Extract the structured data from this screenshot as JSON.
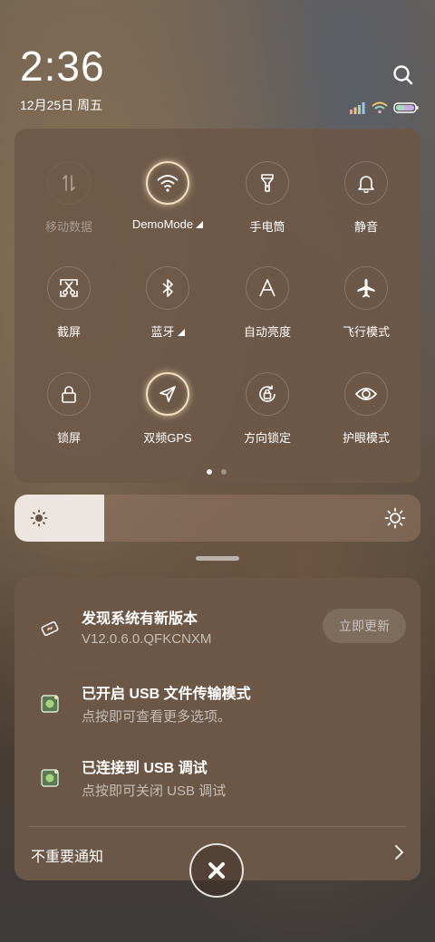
{
  "header": {
    "time": "2:36",
    "date": "12月25日 周五"
  },
  "quick_settings": {
    "tiles": [
      {
        "label": "移动数据",
        "icon": "mobile-data-icon",
        "state": "disabled"
      },
      {
        "label": "DemoMode",
        "icon": "wifi-icon",
        "state": "on",
        "expandable": true
      },
      {
        "label": "手电筒",
        "icon": "flashlight-icon",
        "state": "off"
      },
      {
        "label": "静音",
        "icon": "bell-icon",
        "state": "off"
      },
      {
        "label": "截屏",
        "icon": "screenshot-icon",
        "state": "off"
      },
      {
        "label": "蓝牙",
        "icon": "bluetooth-icon",
        "state": "off",
        "expandable": true
      },
      {
        "label": "自动亮度",
        "icon": "auto-brightness-icon",
        "state": "off"
      },
      {
        "label": "飞行模式",
        "icon": "airplane-icon",
        "state": "off"
      },
      {
        "label": "锁屏",
        "icon": "lock-icon",
        "state": "off"
      },
      {
        "label": "双频GPS",
        "icon": "gps-icon",
        "state": "on"
      },
      {
        "label": "方向锁定",
        "icon": "rotation-lock-icon",
        "state": "off"
      },
      {
        "label": "护眼模式",
        "icon": "eye-icon",
        "state": "off"
      }
    ],
    "page": 1,
    "page_count": 2
  },
  "brightness": {
    "level": 0.22
  },
  "notifications": [
    {
      "title": "发现系统有新版本",
      "subtitle": "V12.0.6.0.QFKCNXM",
      "action": "立即更新",
      "icon": "update-icon"
    },
    {
      "title": "已开启 USB 文件传输模式",
      "subtitle": "点按即可查看更多选项。",
      "icon": "android-usb-icon"
    },
    {
      "title": "已连接到 USB 调试",
      "subtitle": "点按即可关闭 USB 调试",
      "icon": "android-usb-icon"
    }
  ],
  "footer": {
    "unimportant_label": "不重要通知"
  },
  "colors": {
    "panel": "#6e5848",
    "active_ring": "#f2dfbf"
  }
}
